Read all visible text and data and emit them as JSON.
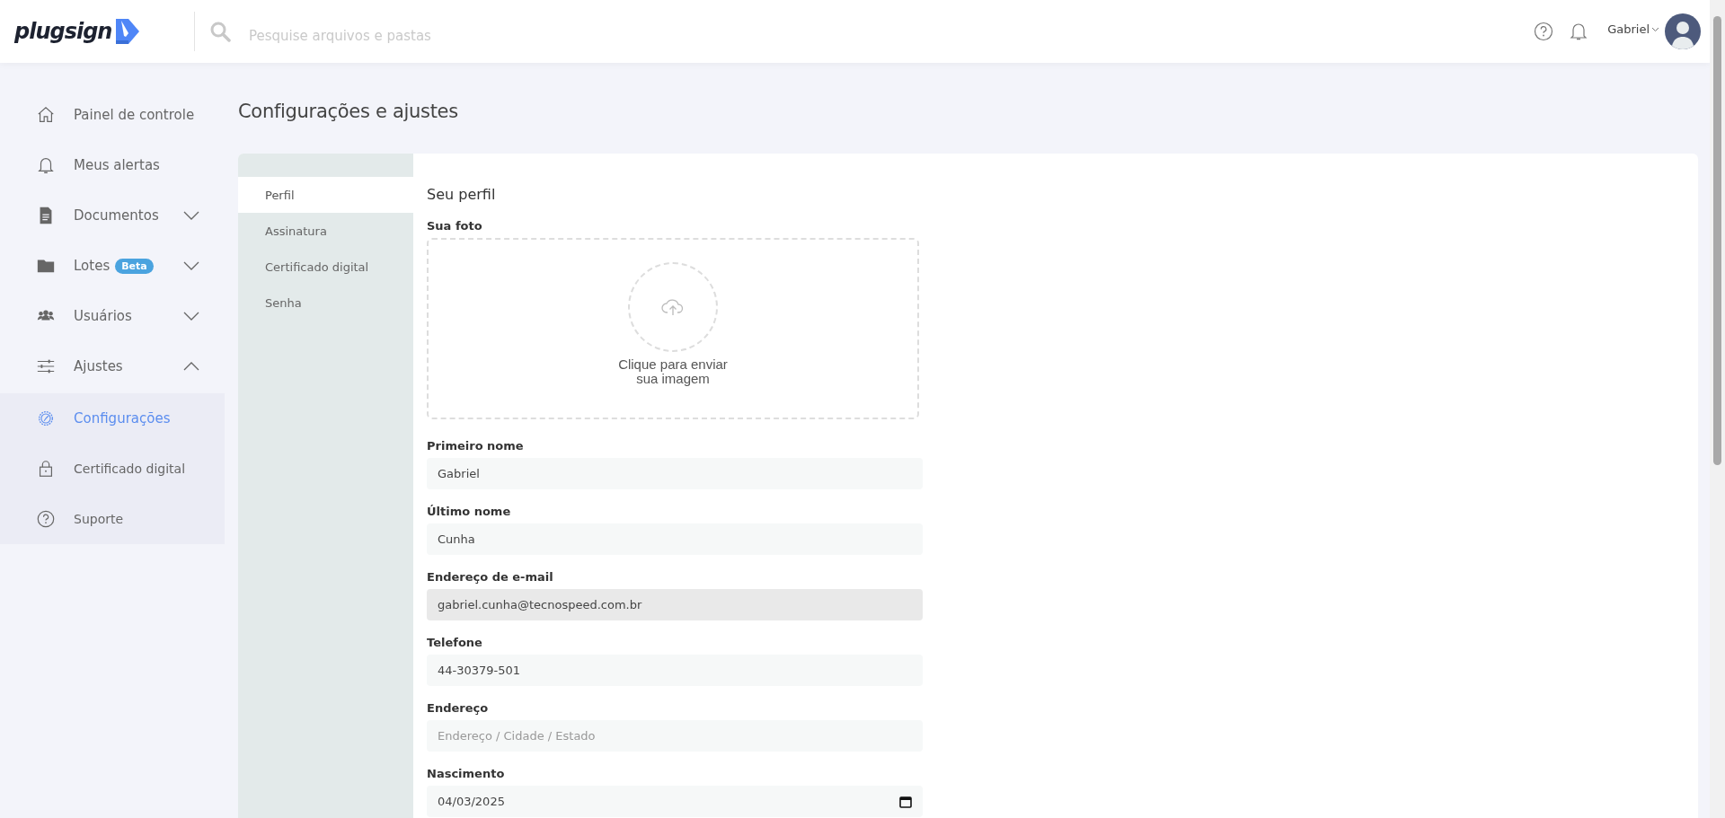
{
  "header": {
    "logo": "plugsign",
    "search": {
      "placeholder": "Pesquise arquivos e pastas"
    },
    "user": {
      "name": "Gabriel"
    }
  },
  "sidebar": {
    "items": [
      {
        "label": "Painel de controle"
      },
      {
        "label": "Meus alertas"
      },
      {
        "label": "Documentos",
        "expanded": false
      },
      {
        "label": "Lotes",
        "badge": "Beta",
        "expanded": false
      },
      {
        "label": "Usuários",
        "expanded": false
      },
      {
        "label": "Ajustes",
        "expanded": true,
        "children": [
          {
            "label": "Configurações",
            "selected": true
          },
          {
            "label": "Certificado digital",
            "selected": false
          },
          {
            "label": "Suporte",
            "selected": false
          }
        ]
      }
    ]
  },
  "page": {
    "title": "Configurações e ajustes"
  },
  "tabs": [
    {
      "label": "Perfil",
      "selected": true
    },
    {
      "label": "Assinatura",
      "selected": false
    },
    {
      "label": "Certificado digital",
      "selected": false
    },
    {
      "label": "Senha",
      "selected": false
    }
  ],
  "profile": {
    "title": "Seu perfil",
    "photo_label": "Sua foto",
    "upload_text": "Clique para enviar sua imagem",
    "fields": [
      {
        "label": "Primeiro nome",
        "value": "Gabriel",
        "disabled": false
      },
      {
        "label": "Último nome",
        "value": "Cunha",
        "disabled": false
      },
      {
        "label": "Endereço de e-mail",
        "value": "gabriel.cunha@tecnospeed.com.br",
        "disabled": true
      },
      {
        "label": "Telefone",
        "value": "44-30379-501",
        "disabled": false
      },
      {
        "label": "Endereço",
        "placeholder": "Endereço / Cidade / Estado",
        "disabled": false
      },
      {
        "label": "Nascimento",
        "value": "04/03/2025",
        "kind": "date",
        "disabled": false
      }
    ]
  }
}
